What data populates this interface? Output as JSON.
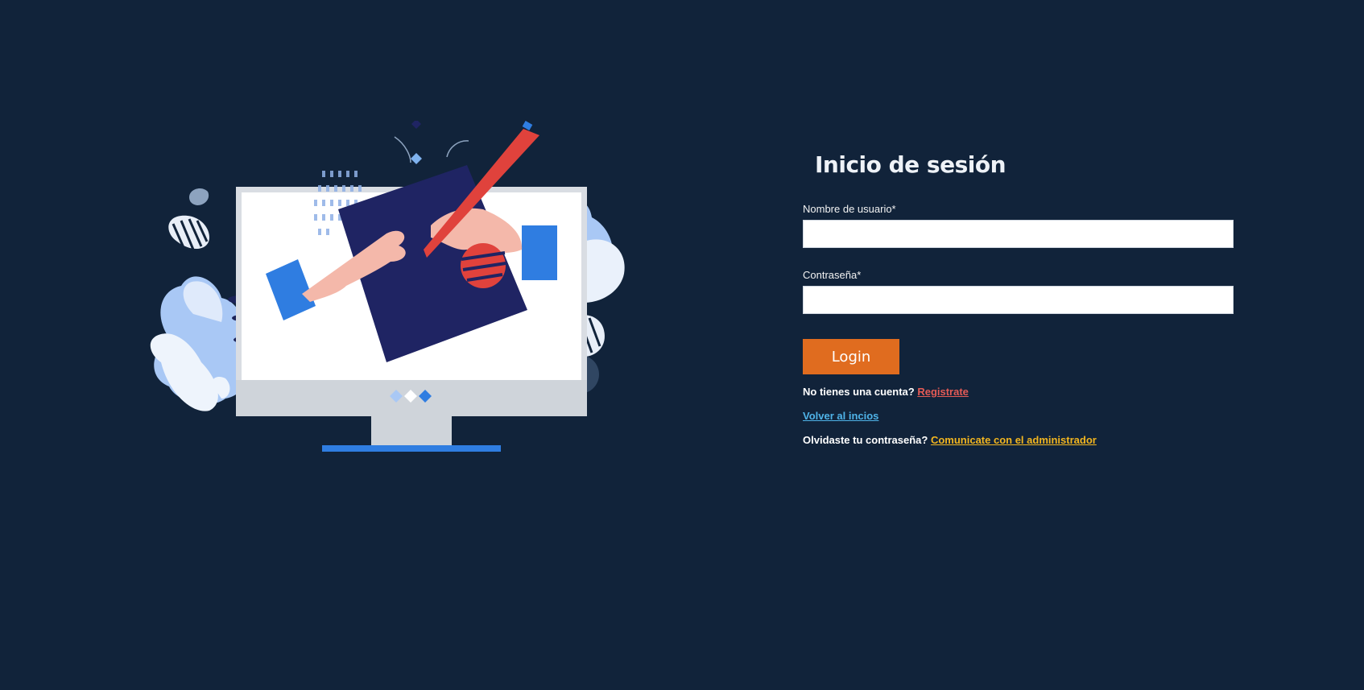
{
  "login": {
    "title": "Inicio de sesión",
    "username_label": "Nombre de usuario*",
    "username_value": "",
    "password_label": "Contraseña*",
    "password_value": "",
    "login_button": "Login",
    "no_account_text": "No tienes una cuenta?",
    "register_link": "Registrate",
    "back_link": "Volver al incios",
    "forgot_text": "Olvidaste tu contraseña?",
    "contact_admin_link": "Comunicate con el administrador"
  },
  "illustration": {
    "icon": "computer-drawing-illustration"
  },
  "colors": {
    "background": "#11233a",
    "button": "#e06c1f",
    "register_link": "#e55b56",
    "back_link": "#4fb3e8",
    "admin_link": "#f3b61f"
  }
}
